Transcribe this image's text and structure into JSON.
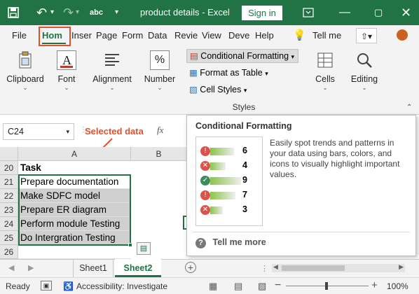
{
  "titlebar": {
    "doc_title": "product details",
    "separator": "-",
    "app_name": "Excel",
    "signin_label": "Sign in",
    "font_indicator": "abc"
  },
  "ribbon_tabs": [
    "File",
    "Hom",
    "Inser",
    "Page",
    "Form",
    "Data",
    "Revie",
    "View",
    "Deve",
    "Help"
  ],
  "tell_me": "Tell me",
  "ribbon_groups": {
    "clipboard": "Clipboard",
    "font": "Font",
    "alignment": "Alignment",
    "number": "Number",
    "conditional_formatting": "Conditional Formatting",
    "format_as_table": "Format as Table",
    "cell_styles": "Cell Styles",
    "styles_label": "Styles",
    "cells": "Cells",
    "editing": "Editing"
  },
  "formula_bar": {
    "name_box": "C24",
    "fx": "fx",
    "annotation": "Selected data"
  },
  "columns": [
    "A",
    "B"
  ],
  "rows": [
    {
      "num": "20",
      "text": "Task"
    },
    {
      "num": "21",
      "text": "Prepare documentation"
    },
    {
      "num": "22",
      "text": "Make SDFC model"
    },
    {
      "num": "23",
      "text": "Prepare ER diagram"
    },
    {
      "num": "24",
      "text": "Perform module Testing"
    },
    {
      "num": "25",
      "text": "Do Intergration Testing"
    },
    {
      "num": "26",
      "text": ""
    }
  ],
  "tooltip": {
    "title": "Conditional Formatting",
    "description": "Easily spot trends and patterns in your data using bars, colors, and icons to visually highlight important values.",
    "sample_values": [
      "6",
      "4",
      "9",
      "7",
      "3"
    ],
    "tell_me_more": "Tell me more"
  },
  "sheets": [
    "Sheet1",
    "Sheet2"
  ],
  "active_sheet": "Sheet2",
  "status": {
    "ready": "Ready",
    "accessibility": "Accessibility: Investigate",
    "zoom": "100%"
  },
  "colors": {
    "excel_green": "#217346",
    "highlight_border": "#e0502a",
    "annotation": "#e0502a"
  }
}
